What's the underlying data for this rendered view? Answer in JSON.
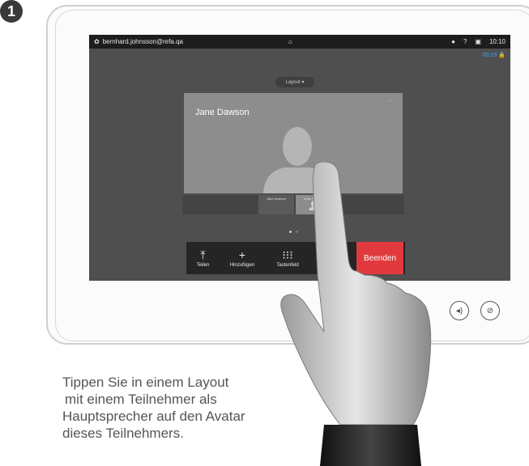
{
  "step": {
    "number": "1"
  },
  "statusbar": {
    "account": "bernhard.johnsson@refa.qa",
    "clock": "10:10"
  },
  "call": {
    "timer": "00:29"
  },
  "layout_button": {
    "label": "Layout"
  },
  "main_video": {
    "participant_name": "Jane Dawson",
    "more": "..."
  },
  "filmstrip": [
    {
      "name": "Jane Dawson"
    },
    {
      "name": "Anita Poscotti"
    }
  ],
  "toolbar": [
    {
      "label": "Teilen",
      "icon": "share-icon"
    },
    {
      "label": "Hinzufügen",
      "icon": "add-icon"
    },
    {
      "label": "Tastenfeld",
      "icon": "keypad-icon"
    }
  ],
  "end_button": {
    "label": "Beenden"
  },
  "caption": {
    "line1": "Tippen Sie in einem Layout",
    "line2": "mit einem Teilnehmer als",
    "line3": "Hauptsprecher auf den Avatar",
    "line4": "dieses Teilnehmers."
  },
  "colors": {
    "screen_bg": "#4f4f4f",
    "statusbar_bg": "#1d1d1d",
    "timer": "#3aa7e8",
    "end_call": "#e03a3e"
  }
}
